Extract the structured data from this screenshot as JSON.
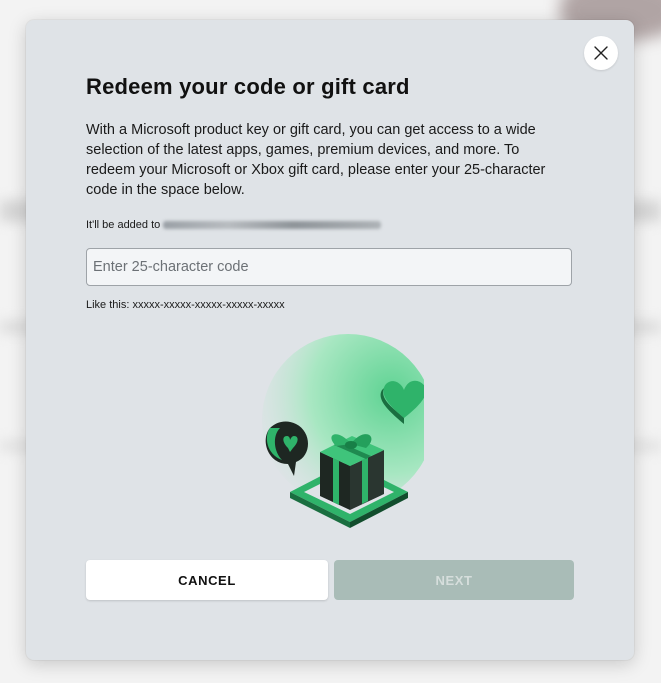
{
  "dialog": {
    "title": "Redeem your code or gift card",
    "description": "With a Microsoft product key or gift card, you can get access to a wide selection of the latest apps, games, premium devices, and more. To redeem your Microsoft or Xbox gift card, please enter your 25-character code in the space below.",
    "added_to_label": "It'll be added to",
    "code_input": {
      "value": "",
      "placeholder": "Enter 25-character code"
    },
    "hint": "Like this: xxxxx-xxxxx-xxxxx-xxxxx-xxxxx",
    "cancel_label": "CANCEL",
    "next_label": "NEXT",
    "close_icon": "close-icon",
    "illustration_icon": "gift-box-illustration"
  },
  "colors": {
    "dialog_bg": "#dfe3e7",
    "accent_green": "#2fb36a",
    "next_disabled_bg": "#a9bcb7",
    "next_disabled_text": "#d6dedc"
  }
}
